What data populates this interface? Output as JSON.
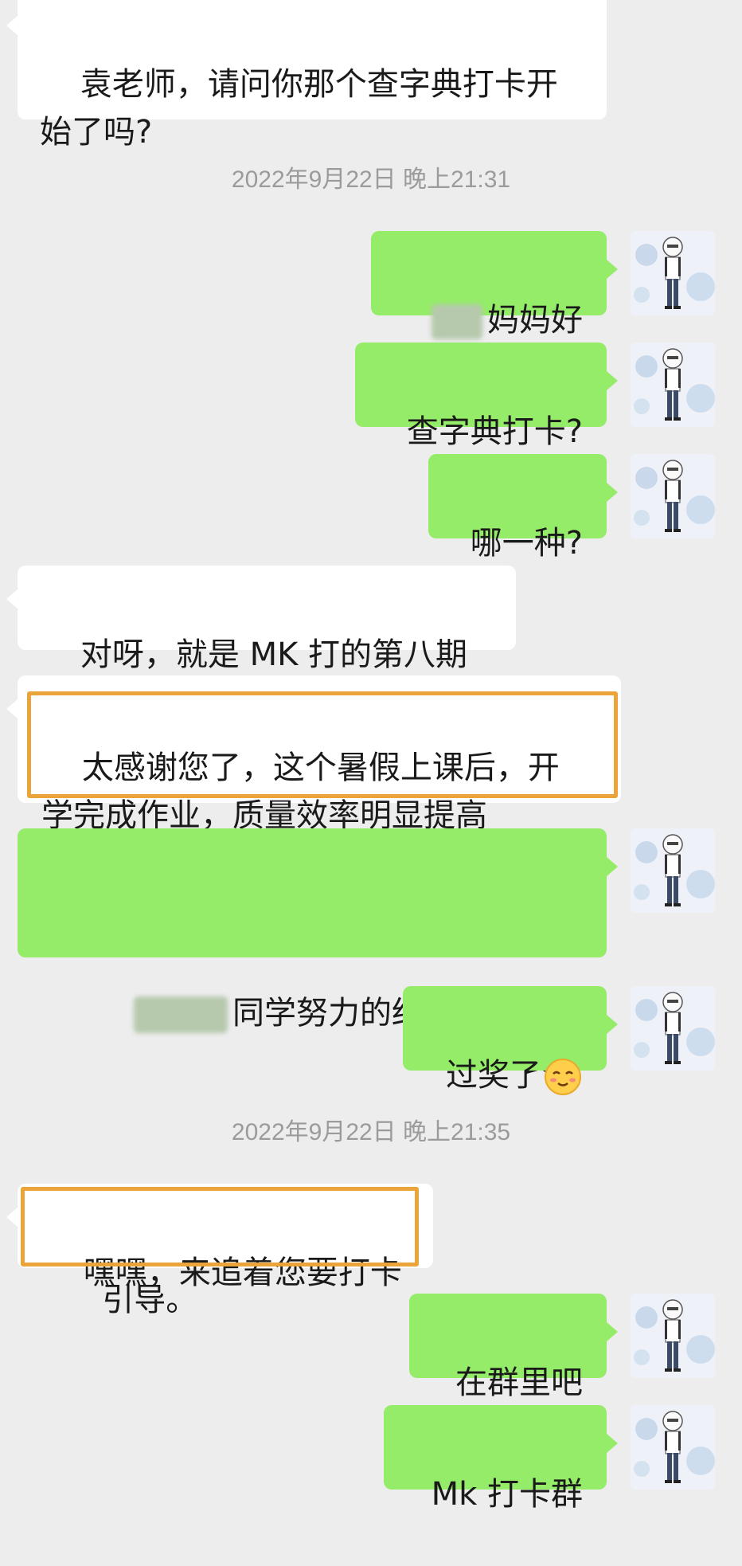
{
  "messages": {
    "m1": "袁老师，请问你那个查字典打卡开\n始了吗?",
    "ts1": "2022年9月22日 晚上21:31",
    "m2": "妈妈好",
    "m3": "查字典打卡?",
    "m4": "哪一种?",
    "m5": "对呀，就是 MK 打的第八期",
    "m6": "太感谢您了，这个暑假上课后，开\n学完成作业，质量效率明显提高",
    "m7a": "同学努力的结果，还有家长的",
    "m7b": "引导。",
    "m8": "过奖了",
    "ts2": "2022年9月22日 晚上21:35",
    "m9": "嘿嘿，来追着您要打卡",
    "m10": "在群里吧",
    "m11": "Mk 打卡群"
  },
  "icons": {
    "avatar": "cartoon-person-avatar",
    "emoji": "shy-smile-emoji"
  },
  "colors": {
    "background": "#ededed",
    "incoming_bubble": "#ffffff",
    "outgoing_bubble": "#95ec69",
    "highlight_frame": "#eaa43a",
    "timestamp": "#9b9b9b"
  }
}
